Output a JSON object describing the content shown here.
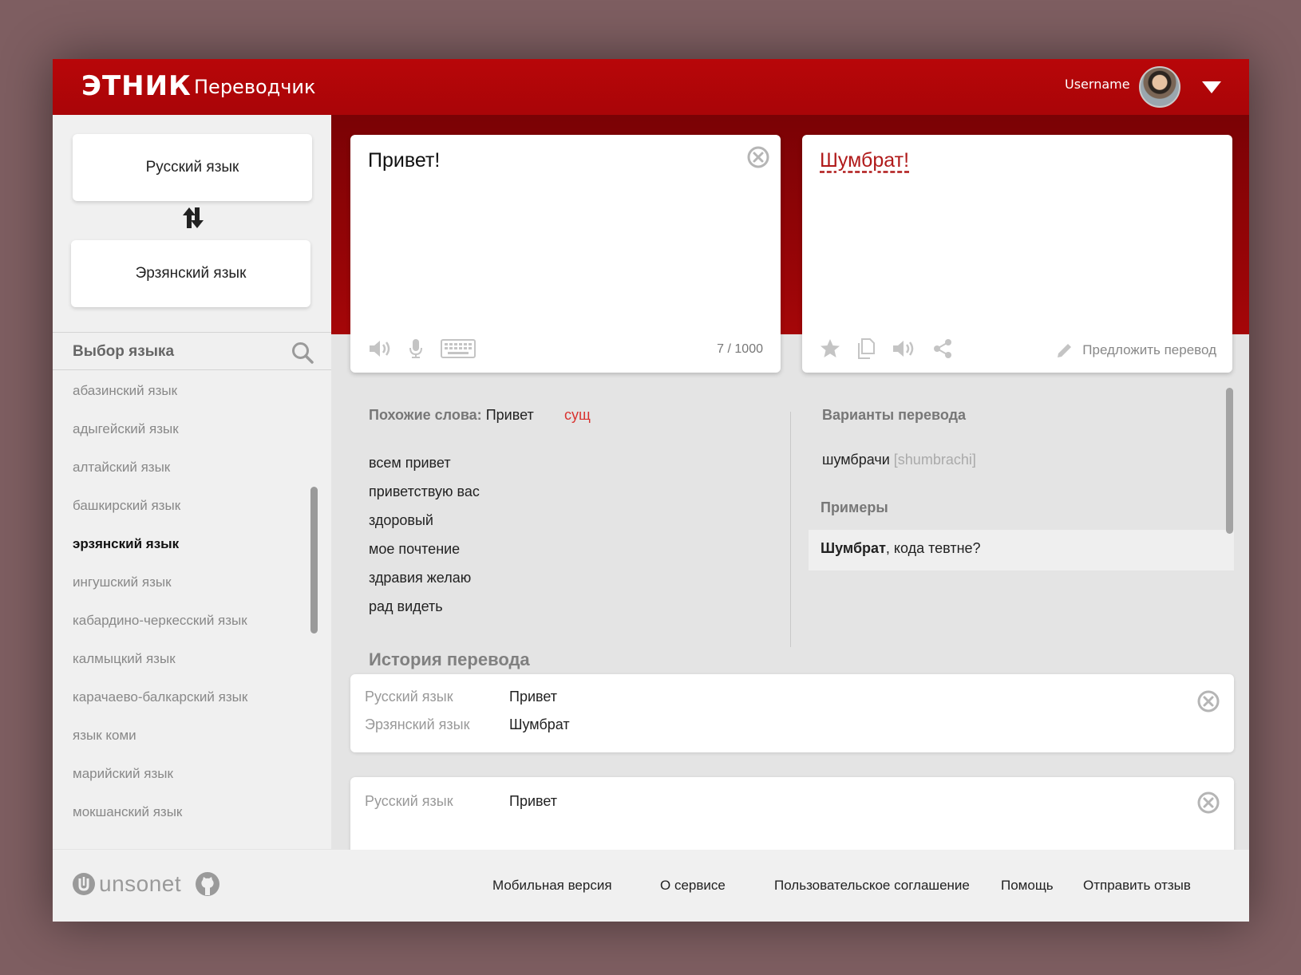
{
  "header": {
    "logo": "ЭТНИК",
    "title": "Переводчик",
    "username": "Username"
  },
  "languages": {
    "source": "Русский язык",
    "target": "Эрзянский язык"
  },
  "language_select": {
    "title": "Выбор языка",
    "items": [
      {
        "label": "абазинский язык",
        "active": false
      },
      {
        "label": "адыгейский язык",
        "active": false
      },
      {
        "label": "алтайский язык",
        "active": false
      },
      {
        "label": "башкирский язык",
        "active": false
      },
      {
        "label": "эрзянский язык",
        "active": true
      },
      {
        "label": "ингушский язык",
        "active": false
      },
      {
        "label": "кабардино-черкесский язык",
        "active": false
      },
      {
        "label": "калмыцкий язык",
        "active": false
      },
      {
        "label": "карачаево-балкарский язык",
        "active": false
      },
      {
        "label": "язык коми",
        "active": false
      },
      {
        "label": "марийский язык",
        "active": false
      },
      {
        "label": "мокшанский язык",
        "active": false
      }
    ]
  },
  "source_panel": {
    "text": "Привет!",
    "char_count": "7 / 1000"
  },
  "target_panel": {
    "text": "Шумбрат!",
    "suggest_label": "Предложить перевод"
  },
  "similar": {
    "label": "Похожие слова:",
    "word": "Привет",
    "pos": "сущ",
    "items": [
      "всем привет",
      "приветствую вас",
      "здоровый",
      "мое почтение",
      "здравия желаю",
      "рад видеть"
    ]
  },
  "variants": {
    "title": "Варианты перевода",
    "word": "шумбрачи",
    "transliteration": "[shumbrachi]"
  },
  "examples": {
    "title": "Примеры",
    "bold": "Шумбрат",
    "rest": ", кода тевтне?"
  },
  "history": {
    "title": "История перевода",
    "entries": [
      {
        "source_lang": "Русский язык",
        "source_word": "Привет",
        "target_lang": "Эрзянский язык",
        "target_word": "Шумбрат"
      },
      {
        "source_lang": "Русский язык",
        "source_word": "Привет"
      }
    ]
  },
  "footer": {
    "brand": "unsonet",
    "links": [
      "Мобильная версия",
      "О сервисе",
      "Пользовательское соглашение",
      "Помощь",
      "Отправить отзыв"
    ]
  },
  "colors": {
    "header_red": "#b80609",
    "accent_red": "#d9322f",
    "background": "#7e5e61"
  }
}
